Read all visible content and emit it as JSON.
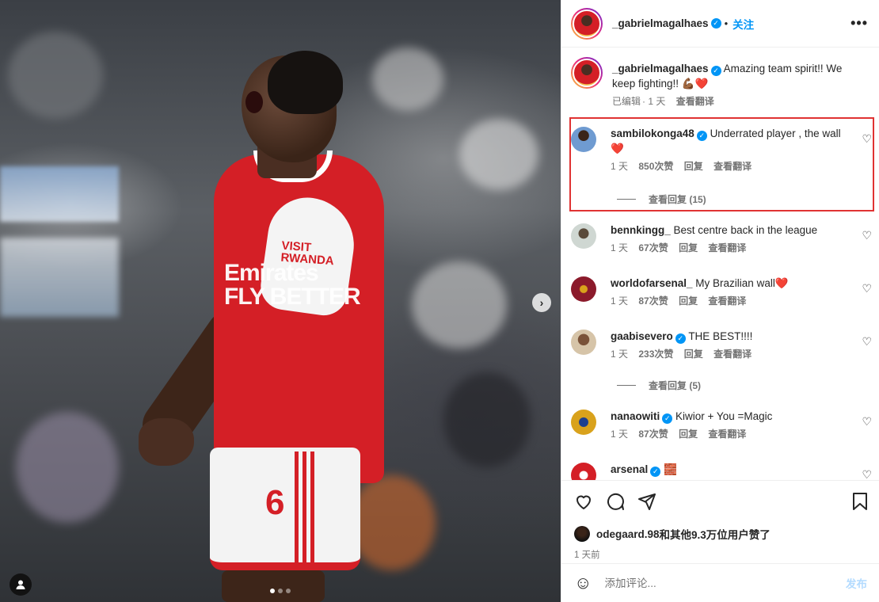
{
  "photo": {
    "sleeve_text": "VISIT\nRWANDA",
    "shirt_text": "Emirates\nFLY BETTER",
    "shirt_number": "6"
  },
  "header": {
    "username": "_gabrielmagalhaes",
    "separator": "•",
    "follow_label": "关注",
    "more_label": "•••"
  },
  "caption": {
    "username": "_gabrielmagalhaes",
    "text": "Amazing team spirit!! We keep fighting!! 💪🏾❤️",
    "edited": "已编辑",
    "time": "1 天",
    "translate": "查看翻译"
  },
  "comments": [
    {
      "username": "sambilokonga48",
      "verified": true,
      "text": "Underrated player , the wall ❤️",
      "time": "1 天",
      "likes": "850次赞",
      "reply": "回复",
      "translate": "查看翻译",
      "view_replies": "查看回复 (15)",
      "avatar_color": "#6f9bd1"
    },
    {
      "username": "bennkingg_",
      "verified": false,
      "text": "Best centre back in the league",
      "time": "1 天",
      "likes": "67次赞",
      "reply": "回复",
      "translate": "查看翻译",
      "avatar_color": "#9aa9a0"
    },
    {
      "username": "worldofarsenal_",
      "verified": false,
      "text": "My Brazilian wall❤️",
      "time": "1 天",
      "likes": "87次赞",
      "reply": "回复",
      "translate": "查看翻译",
      "avatar_color": "#8b1a2b"
    },
    {
      "username": "gaabisevero",
      "verified": true,
      "text": "THE BEST!!!!",
      "time": "1 天",
      "likes": "233次赞",
      "reply": "回复",
      "translate": "查看翻译",
      "view_replies": "查看回复 (5)",
      "avatar_color": "#a07a5a"
    },
    {
      "username": "nanaowiti",
      "verified": true,
      "text": "Kiwior + You =Magic",
      "time": "1 天",
      "likes": "87次赞",
      "reply": "回复",
      "translate": "查看翻译",
      "avatar_color": "#d9a21c"
    },
    {
      "username": "arsenal",
      "verified": true,
      "text": "🧱",
      "avatar_color": "#d41f26"
    }
  ],
  "actions": {
    "likes_user": "odegaard.98",
    "likes_text": "和其他9.3万位用户赞了",
    "time_ago": "1 天前"
  },
  "add_comment": {
    "placeholder": "添加评论...",
    "post_label": "发布"
  }
}
